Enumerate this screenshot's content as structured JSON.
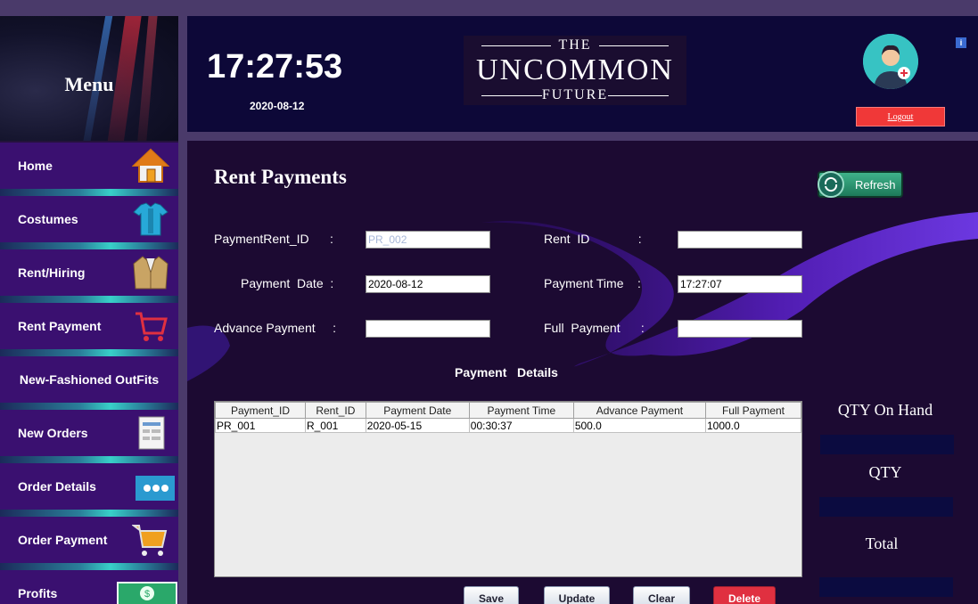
{
  "sidebar": {
    "title": "Menu",
    "items": [
      {
        "label": "Home",
        "icon": "home-icon"
      },
      {
        "label": "Costumes",
        "icon": "shirt-icon"
      },
      {
        "label": "Rent/Hiring",
        "icon": "jacket-icon"
      },
      {
        "label": "Rent Payment",
        "icon": "cart-icon"
      },
      {
        "label": "New-Fashioned OutFits",
        "icon": ""
      },
      {
        "label": "New Orders",
        "icon": "form-icon"
      },
      {
        "label": "Order Details",
        "icon": "more-icon"
      },
      {
        "label": "Order Payment",
        "icon": "shopping-cart-icon"
      },
      {
        "label": "Profits",
        "icon": "money-icon"
      }
    ]
  },
  "header": {
    "time": "17:27:53",
    "date": "2020-08-12",
    "logo": {
      "line1": "THE",
      "line2": "UNCOMMON",
      "line3": "FUTURE"
    },
    "logout_label": "Logout"
  },
  "main": {
    "title": "Rent Payments",
    "refresh_label": "Refresh",
    "form": {
      "payment_rent_id_label": "PaymentRent_ID      :",
      "payment_rent_id_value": "PR_002",
      "rent_id_label": "Rent  ID              :",
      "rent_id_value": "",
      "payment_date_label": "Payment  Date  :",
      "payment_date_value": "2020-08-12",
      "payment_time_label": "Payment Time    :",
      "payment_time_value": "17:27:07",
      "advance_payment_label": "Advance Payment     :",
      "advance_payment_value": "",
      "full_payment_label": "Full  Payment      :",
      "full_payment_value": ""
    },
    "section_title": "Payment   Details",
    "table": {
      "columns": [
        "Payment_ID",
        "Rent_ID",
        "Payment Date",
        "Payment Time",
        "Advance Payment",
        "Full Payment"
      ],
      "rows": [
        [
          "PR_001",
          "R_001",
          "2020-05-15",
          "00:30:37",
          "500.0",
          "1000.0"
        ]
      ]
    },
    "side": {
      "qty_on_hand_label": "QTY On Hand",
      "qty_label": "QTY",
      "total_label": "Total"
    },
    "buttons": {
      "save": "Save",
      "update": "Update",
      "clear": "Clear",
      "delete": "Delete"
    }
  },
  "colors": {
    "accent": "#3a1070",
    "header": "#0d0838",
    "logout": "#f03838",
    "delete": "#e03040"
  }
}
